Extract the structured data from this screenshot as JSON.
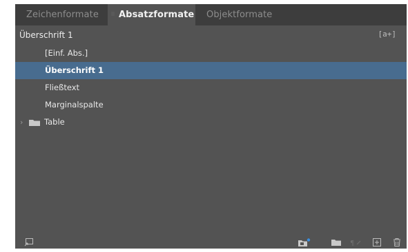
{
  "tabs": [
    {
      "label": "Zeichenformate",
      "active": false
    },
    {
      "label": "Absatzformate",
      "active": true
    },
    {
      "label": "Objektformate",
      "active": false
    }
  ],
  "header": {
    "current_style": "Überschrift 1",
    "override_icon_text": "[a+]"
  },
  "styles": [
    {
      "label": "[Einf. Abs.]",
      "selected": false
    },
    {
      "label": "Überschrift 1",
      "selected": true
    },
    {
      "label": "Fließtext",
      "selected": false
    },
    {
      "label": "Marginalspalte",
      "selected": false
    },
    {
      "label": "Table",
      "type": "group",
      "expanded": false
    }
  ],
  "footer_icons": [
    "load-styles-icon",
    "new-style-group-from-selection-icon",
    "new-style-group-icon",
    "clear-overrides-icon",
    "new-style-icon",
    "delete-style-icon"
  ],
  "colors": {
    "panel_bg": "#535353",
    "tabbar_bg": "#3d3d3d",
    "selection": "#486c8f",
    "accent_blue": "#3b8fe0"
  }
}
